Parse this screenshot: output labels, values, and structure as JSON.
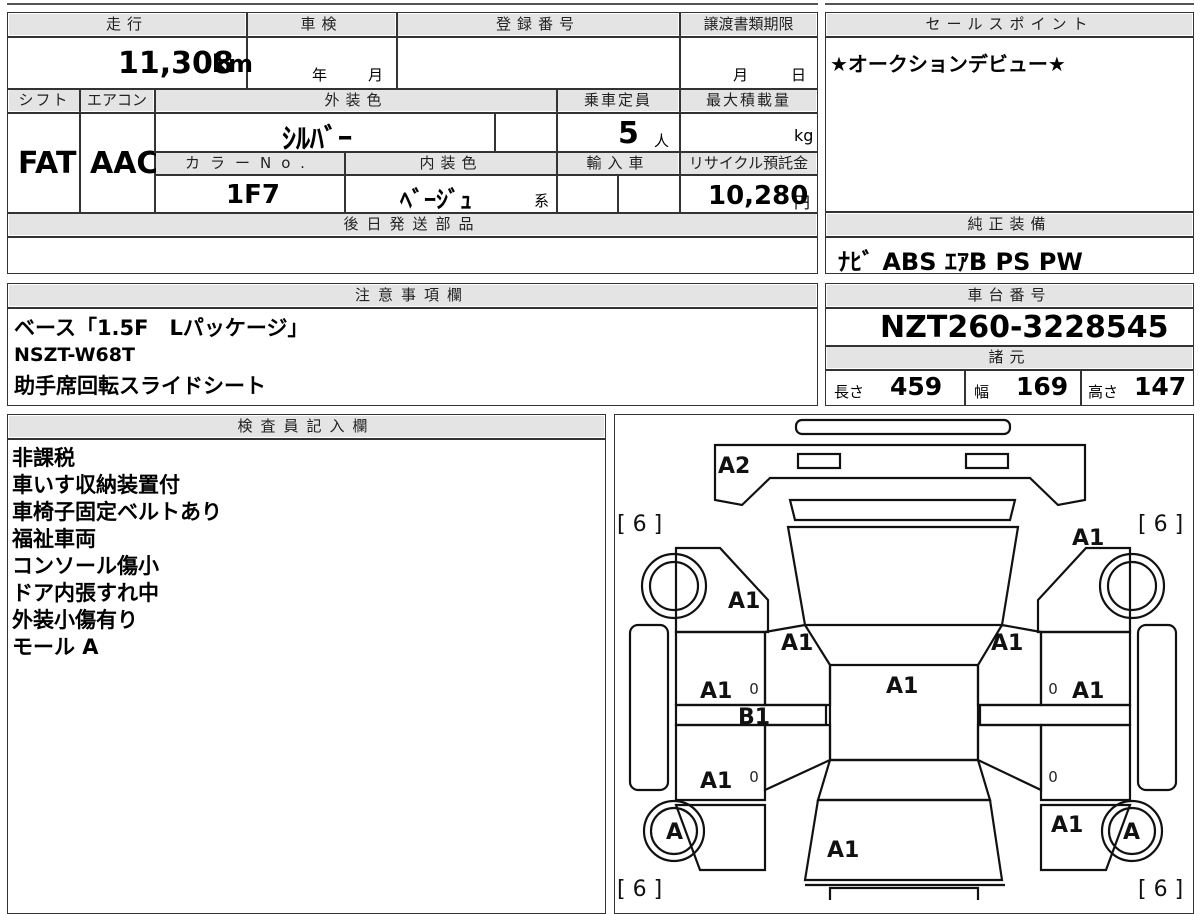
{
  "top_box": {
    "headers": {
      "mileage": "走行",
      "inspection": "車検",
      "registration": "登録番号",
      "transfer_deadline": "譲渡書類期限",
      "shift": "シフト",
      "aircon": "エアコン",
      "exterior_color": "外装色",
      "capacity": "乗車定員",
      "max_load": "最大積載量",
      "color_no": "カラーNo.",
      "interior_color": "内装色",
      "import": "輸入車",
      "recycle": "リサイクル預託金",
      "later_parts": "後日発送部品"
    },
    "mileage_value": "11,308",
    "mileage_unit": "km",
    "inspection_year": "年",
    "inspection_month": "月",
    "transfer_month": "月",
    "transfer_day": "日",
    "shift_value": "FAT",
    "aircon_value": "AAC",
    "exterior_value": "ｼﾙﾊﾞｰ",
    "capacity_value": "5",
    "capacity_unit": "人",
    "max_load_unit": "kg",
    "color_no_value": "1F7",
    "interior_value": "ﾍﾞｰｼﾞｭ",
    "interior_suffix": "系",
    "recycle_value": "10,280",
    "recycle_unit": "円"
  },
  "sales_point": {
    "header": "セールスポイント",
    "text": "★オークションデビュー★"
  },
  "equipment": {
    "header": "純正装備",
    "text": "ﾅﾋﾞ ABS ｴｱB PS PW"
  },
  "notes": {
    "header": "注意事項欄",
    "lines": [
      "ベース「1.5F　Lパッケージ」",
      "NSZT-W68T",
      "助手席回転スライドシート"
    ]
  },
  "chassis": {
    "header": "車台番号",
    "value": "NZT260-3228545"
  },
  "specs": {
    "header": "諸元",
    "length_label": "長さ",
    "length_value": "459",
    "width_label": "幅",
    "width_value": "169",
    "height_label": "高さ",
    "height_value": "147"
  },
  "inspector": {
    "header": "検査員記入欄",
    "lines": [
      "非課税",
      "車いす収納装置付",
      "車椅子固定ベルトあり",
      "福祉車両",
      "コンソール傷小",
      "ドア内張すれ中",
      "外装小傷有り",
      "モール A"
    ]
  },
  "diagram": {
    "tire_tl": "[ 6 ]",
    "tire_tr": "[ 6 ]",
    "tire_bl": "[ 6 ]",
    "tire_br": "[ 6 ]",
    "marks": {
      "front_bumper": "A2",
      "right_fender": "A1",
      "left_fender": "A1",
      "left_pillar": "A1",
      "right_pillar": "A1",
      "roof": "A1",
      "left_front_door": "A1",
      "right_front_door": "A1",
      "left_step": "B1",
      "left_rear_door": "A1",
      "right_rear_qtr": "A1",
      "rear_glass": "A1",
      "left_wheel": "A",
      "right_wheel": "A",
      "zero_1": "0",
      "zero_2": "0",
      "zero_3": "0",
      "zero_4": "0"
    }
  }
}
